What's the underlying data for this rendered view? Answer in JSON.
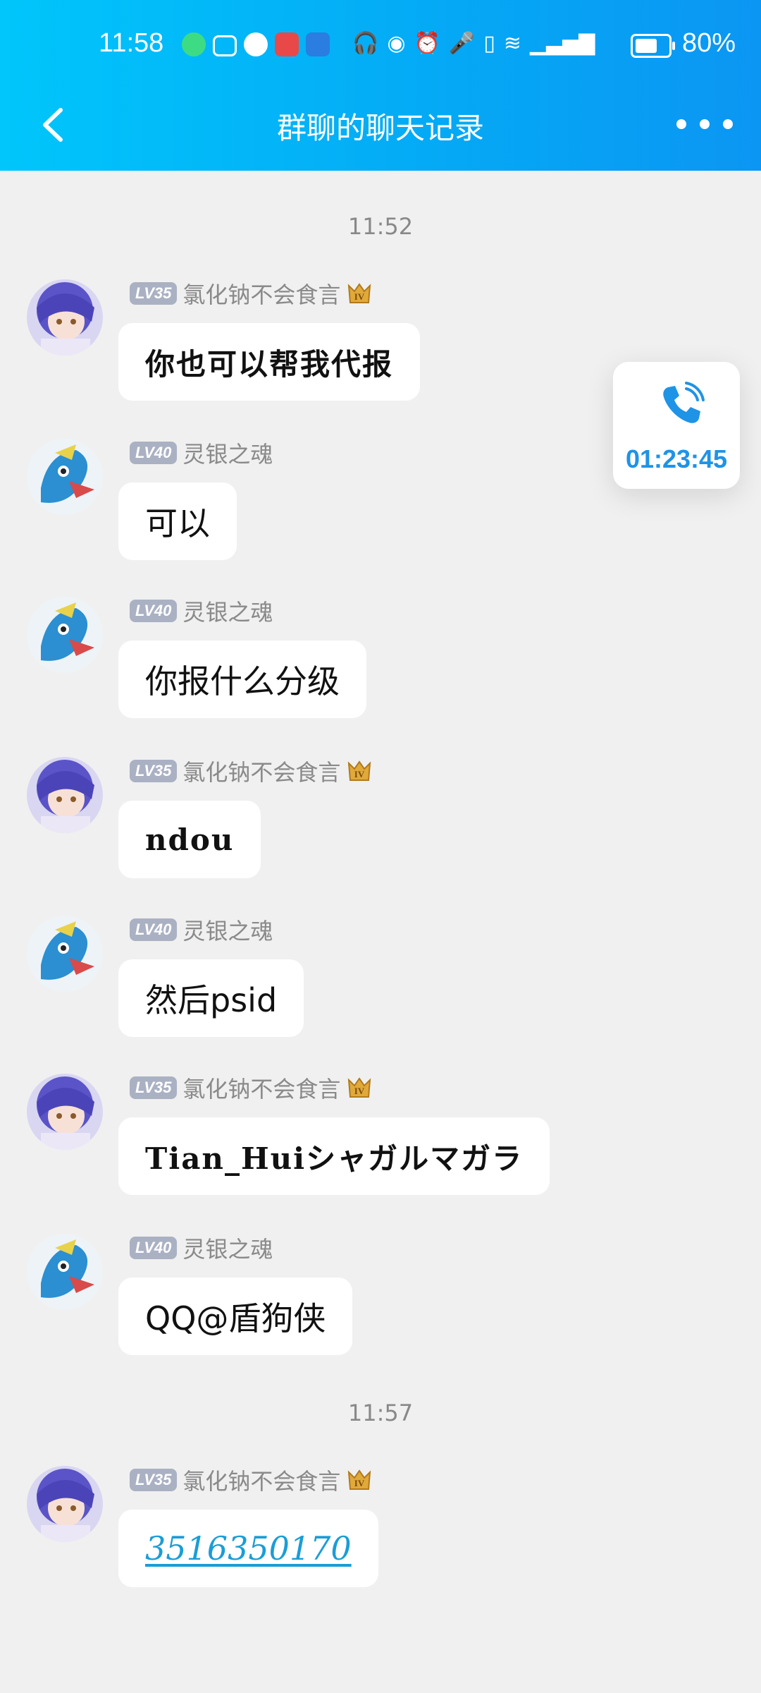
{
  "status_bar": {
    "time": "11:58",
    "battery_percent": "80%",
    "battery_level": 0.8
  },
  "header": {
    "title": "群聊的聊天记录"
  },
  "call_widget": {
    "duration": "01:23:45"
  },
  "timestamps": [
    "11:52",
    "11:57"
  ],
  "messages": [
    {
      "level": "LV35",
      "sender": "氯化钠不会食言",
      "text": "你也可以帮我代报",
      "style": "hand",
      "avatar": "girl"
    },
    {
      "level": "LV40",
      "sender": "灵银之魂",
      "text": "可以",
      "style": "normal",
      "avatar": "dragon"
    },
    {
      "level": "LV40",
      "sender": "灵银之魂",
      "text": "你报什么分级",
      "style": "normal",
      "avatar": "dragon"
    },
    {
      "level": "LV35",
      "sender": "氯化钠不会食言",
      "text": "ndou",
      "style": "hand",
      "avatar": "girl"
    },
    {
      "level": "LV40",
      "sender": "灵银之魂",
      "text": "然后psid",
      "style": "normal",
      "avatar": "dragon"
    },
    {
      "level": "LV35",
      "sender": "氯化钠不会食言",
      "text": "Tian_Huiシャガルマガラ",
      "style": "hand",
      "avatar": "girl"
    },
    {
      "level": "LV40",
      "sender": "灵银之魂",
      "text": "QQ@盾狗侠",
      "style": "normal",
      "avatar": "dragon"
    },
    {
      "level": "LV35",
      "sender": "氯化钠不会食言",
      "text": "3516350170",
      "style": "link",
      "avatar": "girl"
    }
  ]
}
